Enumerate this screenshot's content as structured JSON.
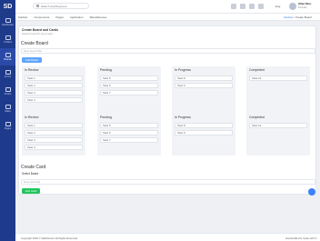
{
  "sidebar": {
    "logo": "SD",
    "items": [
      {
        "label": "Dashboard",
        "icon": "dashboard-icon"
      },
      {
        "label": "UI Elem",
        "icon": "layers-icon"
      },
      {
        "label": "Boards",
        "icon": "board-icon"
      },
      {
        "label": "Forms",
        "icon": "form-icon"
      },
      {
        "label": "Charts",
        "icon": "chart-icon"
      },
      {
        "label": "Maps",
        "icon": "map-icon"
      },
      {
        "label": "Pages",
        "icon": "pages-icon"
      }
    ]
  },
  "header": {
    "search_placeholder": "Search anything here",
    "lang": "Eng",
    "user_name": "Allen Moo",
    "user_role": "Founder"
  },
  "subnav": {
    "items": [
      "Kanban",
      "Components",
      "Pages",
      "Application",
      "Miscellaneous"
    ]
  },
  "breadcrumb": {
    "home": "Kanban",
    "sep": " / ",
    "current": "Create Board"
  },
  "page": {
    "title": "Create Board and Cards",
    "subtitle": "Kanban board for your project",
    "board_heading": "Create Board",
    "board_placeholder": "New board title",
    "board_button": "Add Board",
    "card_heading": "Create Card",
    "card_sub": "Select Board",
    "card_placeholder": "New card title",
    "card_button": "Add Card"
  },
  "boards": [
    [
      {
        "title": "In Review",
        "tasks": [
          "Task 1",
          "Task 2",
          "Task 3",
          "Task 4"
        ]
      },
      {
        "title": "Pending",
        "tasks": [
          "Task 5",
          "Task 6",
          "Task 7"
        ]
      },
      {
        "title": "In Progress",
        "tasks": [
          "Task 8",
          "Task 9"
        ]
      },
      {
        "title": "Completed",
        "tasks": [
          "Task 10"
        ]
      }
    ],
    [
      {
        "title": "In Review",
        "tasks": [
          "Task 1",
          "Task 2",
          "Task 3",
          "Task 4"
        ]
      },
      {
        "title": "Pending",
        "tasks": [
          "Task 5",
          "Task 6",
          "Task 7"
        ]
      },
      {
        "title": "In Progress",
        "tasks": [
          "Task 8",
          "Task 9"
        ]
      },
      {
        "title": "Completed",
        "tasks": [
          "Task 10"
        ]
      }
    ]
  ],
  "footer": {
    "left": "Copyright 2022 © Dashboard. All Rights Reserved",
    "right": "Handcrafted & made with ♥"
  },
  "colors": {
    "sidebar": "#1e3a8a",
    "primary": "#60a5fa",
    "success": "#22c55e"
  }
}
